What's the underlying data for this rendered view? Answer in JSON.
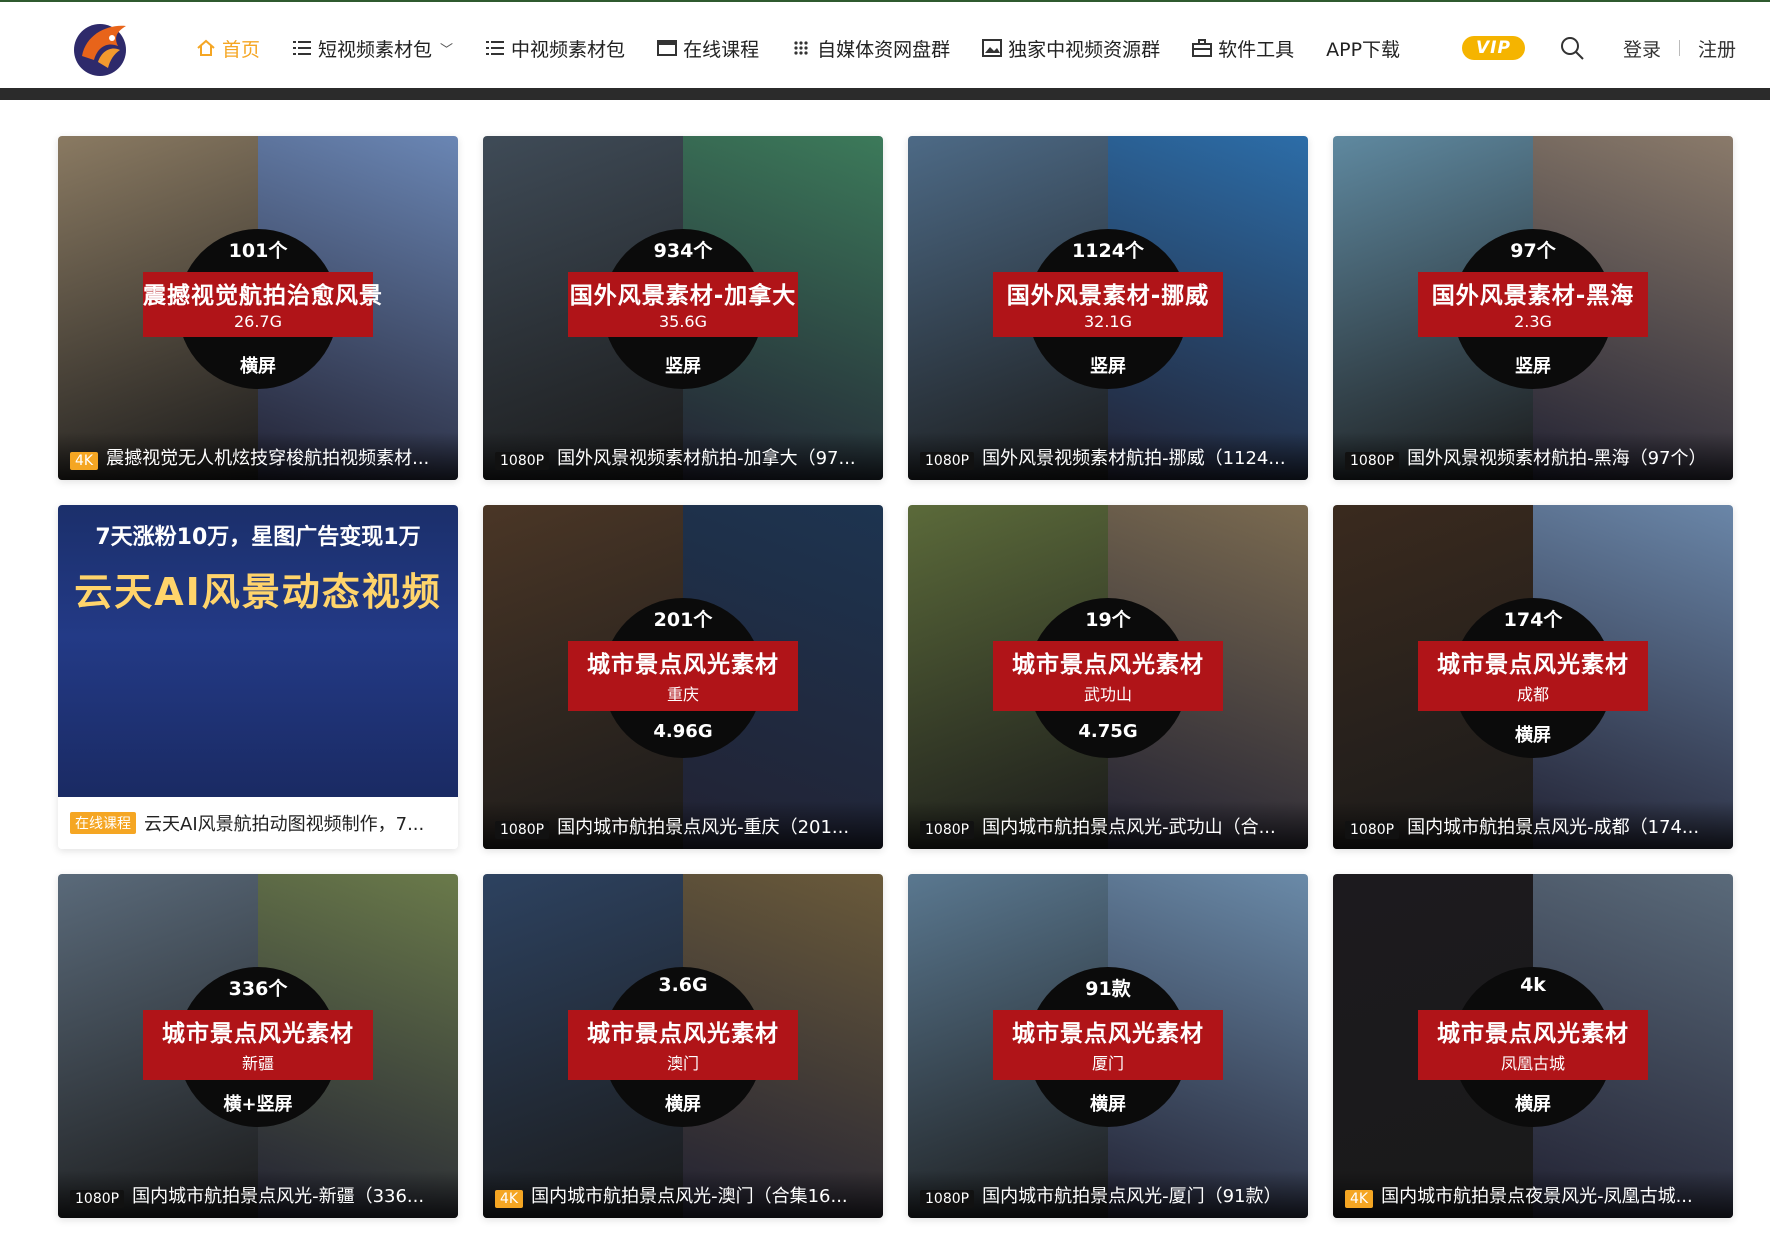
{
  "nav": {
    "items": [
      {
        "label": "首页",
        "icon": "home-icon",
        "active": true
      },
      {
        "label": "短视频素材包",
        "icon": "list-icon",
        "dropdown": true
      },
      {
        "label": "中视频素材包",
        "icon": "list-icon"
      },
      {
        "label": "在线课程",
        "icon": "window-icon"
      },
      {
        "label": "自媒体资网盘群",
        "icon": "grid-dots-icon"
      },
      {
        "label": "独家中视频资源群",
        "icon": "image-icon"
      },
      {
        "label": "软件工具",
        "icon": "toolbox-icon"
      },
      {
        "label": "APP下载",
        "icon": ""
      }
    ],
    "vip_label": "VIP",
    "login": "登录",
    "register": "注册"
  },
  "cards": [
    {
      "count": "101个",
      "title": "震撼视觉航拍治愈风景",
      "sub": "26.7G",
      "fmt": "横屏",
      "badge": "4K",
      "badge_style": "orange",
      "caption": "震撼视觉无人机炫技穿梭航拍视频素材...",
      "left_color": "#8a7a62",
      "right_color": "#6a86b4"
    },
    {
      "count": "934个",
      "title": "国外风景素材-加拿大",
      "sub": "35.6G",
      "fmt": "竖屏",
      "badge": "1080P",
      "badge_style": "dark",
      "caption": "国外风景视频素材航拍-加拿大（97...",
      "left_color": "#3f4b57",
      "right_color": "#3c7a5a"
    },
    {
      "count": "1124个",
      "title": "国外风景素材-挪威",
      "sub": "32.1G",
      "fmt": "竖屏",
      "badge": "1080P",
      "badge_style": "dark",
      "caption": "国外风景视频素材航拍-挪威（1124...",
      "left_color": "#4d6a86",
      "right_color": "#2c6da8"
    },
    {
      "count": "97个",
      "title": "国外风景素材-黑海",
      "sub": "2.3G",
      "fmt": "竖屏",
      "badge": "1080P",
      "badge_style": "dark",
      "caption": "国外风景视频素材航拍-黑海（97个）",
      "left_color": "#5f89a0",
      "right_color": "#8a7a6a"
    },
    {
      "ad": true,
      "ad_line1": "7天涨粉10万，星图广告变现1万",
      "ad_line2": "云天AI风景动态视频",
      "badge": "在线课程",
      "caption": "云天AI风景航拍动图视频制作，7..."
    },
    {
      "count": "201个",
      "title": "城市景点风光素材",
      "sub": "重庆",
      "fmt": "4.96G",
      "badge": "1080P",
      "badge_style": "dark",
      "caption": "国内城市航拍景点风光-重庆（201...",
      "left_color": "#4a3626",
      "right_color": "#1d3450"
    },
    {
      "count": "19个",
      "title": "城市景点风光素材",
      "sub": "武功山",
      "fmt": "4.75G",
      "badge": "1080P",
      "badge_style": "dark",
      "caption": "国内城市航拍景点风光-武功山（合...",
      "left_color": "#5b6a3a",
      "right_color": "#7a6a50"
    },
    {
      "count": "174个",
      "title": "城市景点风光素材",
      "sub": "成都",
      "fmt": "横屏",
      "badge": "1080P",
      "badge_style": "dark",
      "caption": "国内城市航拍景点风光-成都（174...",
      "left_color": "#3a2a1e",
      "right_color": "#6a86a8"
    },
    {
      "count": "336个",
      "title": "城市景点风光素材",
      "sub": "新疆",
      "fmt": "横+竖屏",
      "badge": "1080P",
      "badge_style": "dark",
      "caption": "国内城市航拍景点风光-新疆（336...",
      "left_color": "#5a6a7a",
      "right_color": "#6a7a4a"
    },
    {
      "count": "3.6G",
      "title": "城市景点风光素材",
      "sub": "澳门",
      "fmt": "横屏",
      "badge": "4K",
      "badge_style": "orange",
      "caption": "国内城市航拍景点风光-澳门（合集16...",
      "left_color": "#2d4260",
      "right_color": "#6a5a3a"
    },
    {
      "count": "91款",
      "title": "城市景点风光素材",
      "sub": "厦门",
      "fmt": "横屏",
      "badge": "1080P",
      "badge_style": "dark",
      "caption": "国内城市航拍景点风光-厦门（91款）",
      "left_color": "#5a7890",
      "right_color": "#6a8aa8"
    },
    {
      "count": "4k",
      "title": "城市景点风光素材",
      "sub": "凤凰古城",
      "fmt": "横屏",
      "badge": "4K",
      "badge_style": "orange",
      "caption": "国内城市航拍景点夜景风光-凤凰古城...",
      "left_color": "#1c1a1e",
      "right_color": "#5a6a7a"
    }
  ]
}
